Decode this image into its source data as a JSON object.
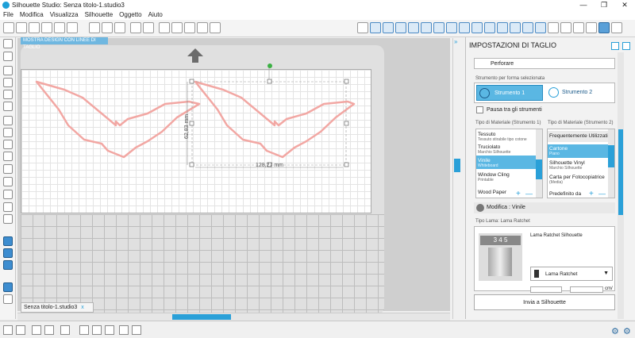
{
  "window": {
    "title": "Silhouette Studio: Senza titolo-1.studio3",
    "minimize": "—",
    "restore": "❐",
    "close": "✕"
  },
  "menu": [
    "File",
    "Modifica",
    "Visualizza",
    "Silhouette",
    "Oggetto",
    "Aiuto"
  ],
  "canvas": {
    "ribbon_label": "MOSTRA DESIGN CON LINEE DI TAGLIO",
    "height_label": "62,83 mm",
    "width_label": "128,27 mm",
    "doc_tab": "Senza titolo-1.studio3",
    "doc_tab_close": "x"
  },
  "panel": {
    "title": "IMPOSTAZIONI DI TAGLIO",
    "perforate": "Perforare",
    "tool_section": "Strumento per forma selezionata",
    "tool1": "Strumento 1",
    "tool2": "Strumento 2",
    "pause_label": "Pausa tra gli strumenti",
    "mat_header1": "Tipo di Materiale (Strumento 1)",
    "mat_header2": "Tipo di Materiale (Strumento 2)",
    "materials1": [
      {
        "name": "Tessuto",
        "sub": "Tessuto stirabile tipo cotone"
      },
      {
        "name": "Truciolato",
        "sub": "Marchio Silhouette"
      },
      {
        "name": "Vinile",
        "sub": "Whiteboard"
      },
      {
        "name": "Window Cling",
        "sub": "Printable"
      },
      {
        "name": "Wood Paper",
        "sub": ""
      }
    ],
    "materials2_header": "Frequentemente Utilizzati",
    "materials2": [
      {
        "name": "Cartone",
        "sub": "Piano"
      },
      {
        "name": "Silhouette Vinyl",
        "sub": "Marchio Silhouette"
      },
      {
        "name": "Carta per Fotocopiatrice",
        "sub": "(Media)"
      },
      {
        "name": "Predefinito da",
        "sub": ""
      }
    ],
    "plus": "+",
    "minus": "—",
    "modify_label": "Modifica : Vinile",
    "blade_section": "Tipo Lama: Lama Ratchet",
    "blade_name": "Lama Ratchet Silhouette",
    "blade_select": "Lama Ratchet",
    "blade_digits": "3 4 5",
    "unit": "cm/",
    "send_button": "Invia a Silhouette",
    "collapse": "»"
  },
  "colors": {
    "accent": "#2aa0d8",
    "shape": "#f2a7a3",
    "selected": "#5ab7e3"
  }
}
